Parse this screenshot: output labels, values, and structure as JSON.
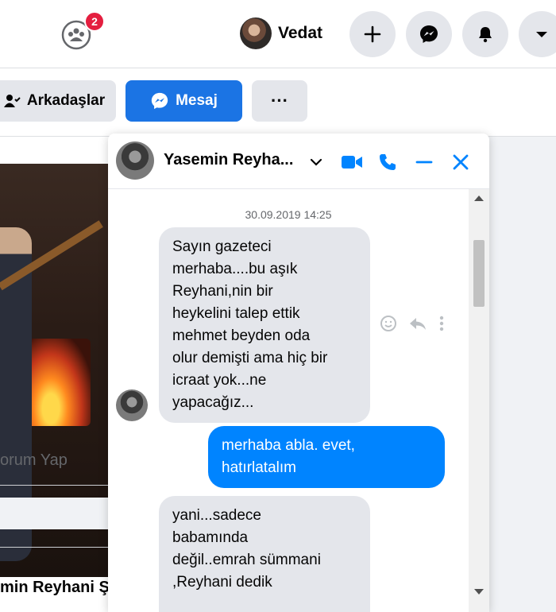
{
  "topbar": {
    "groups_badge": "2",
    "profile_name": "Vedat",
    "icons": [
      "groups-icon",
      "plus-icon",
      "messenger-icon",
      "bell-icon",
      "caret-down-icon"
    ]
  },
  "profile_actions": {
    "friends_label": "Arkadaşlar",
    "message_label": "Mesaj",
    "more_label": "···"
  },
  "post": {
    "comment_label": "orum Yap",
    "author_name": "min Reyhani Şa"
  },
  "chat": {
    "contact_name": "Yasemin Reyha...",
    "timestamp": "30.09.2019 14:25",
    "messages": [
      {
        "direction": "incoming",
        "lines": [
          "Sayın gazeteci",
          "merhaba....bu aşık",
          "Reyhani,nin bir",
          "heykelini talep ettik",
          "mehmet beyden oda",
          "olur demişti ama hiç bir",
          "icraat yok...ne",
          "yapacağız..."
        ]
      },
      {
        "direction": "outgoing",
        "lines": [
          "merhaba abla. evet,",
          "hatırlatalım"
        ]
      },
      {
        "direction": "incoming",
        "lines": [
          "yani...sadece",
          "babamında",
          "değil..emrah sümmani",
          ",Reyhani dedik"
        ]
      }
    ]
  },
  "colors": {
    "accent": "#1b74e4",
    "outgoing_bubble": "#0084ff",
    "incoming_bubble": "#e4e6eb",
    "badge": "#e41e3f"
  }
}
